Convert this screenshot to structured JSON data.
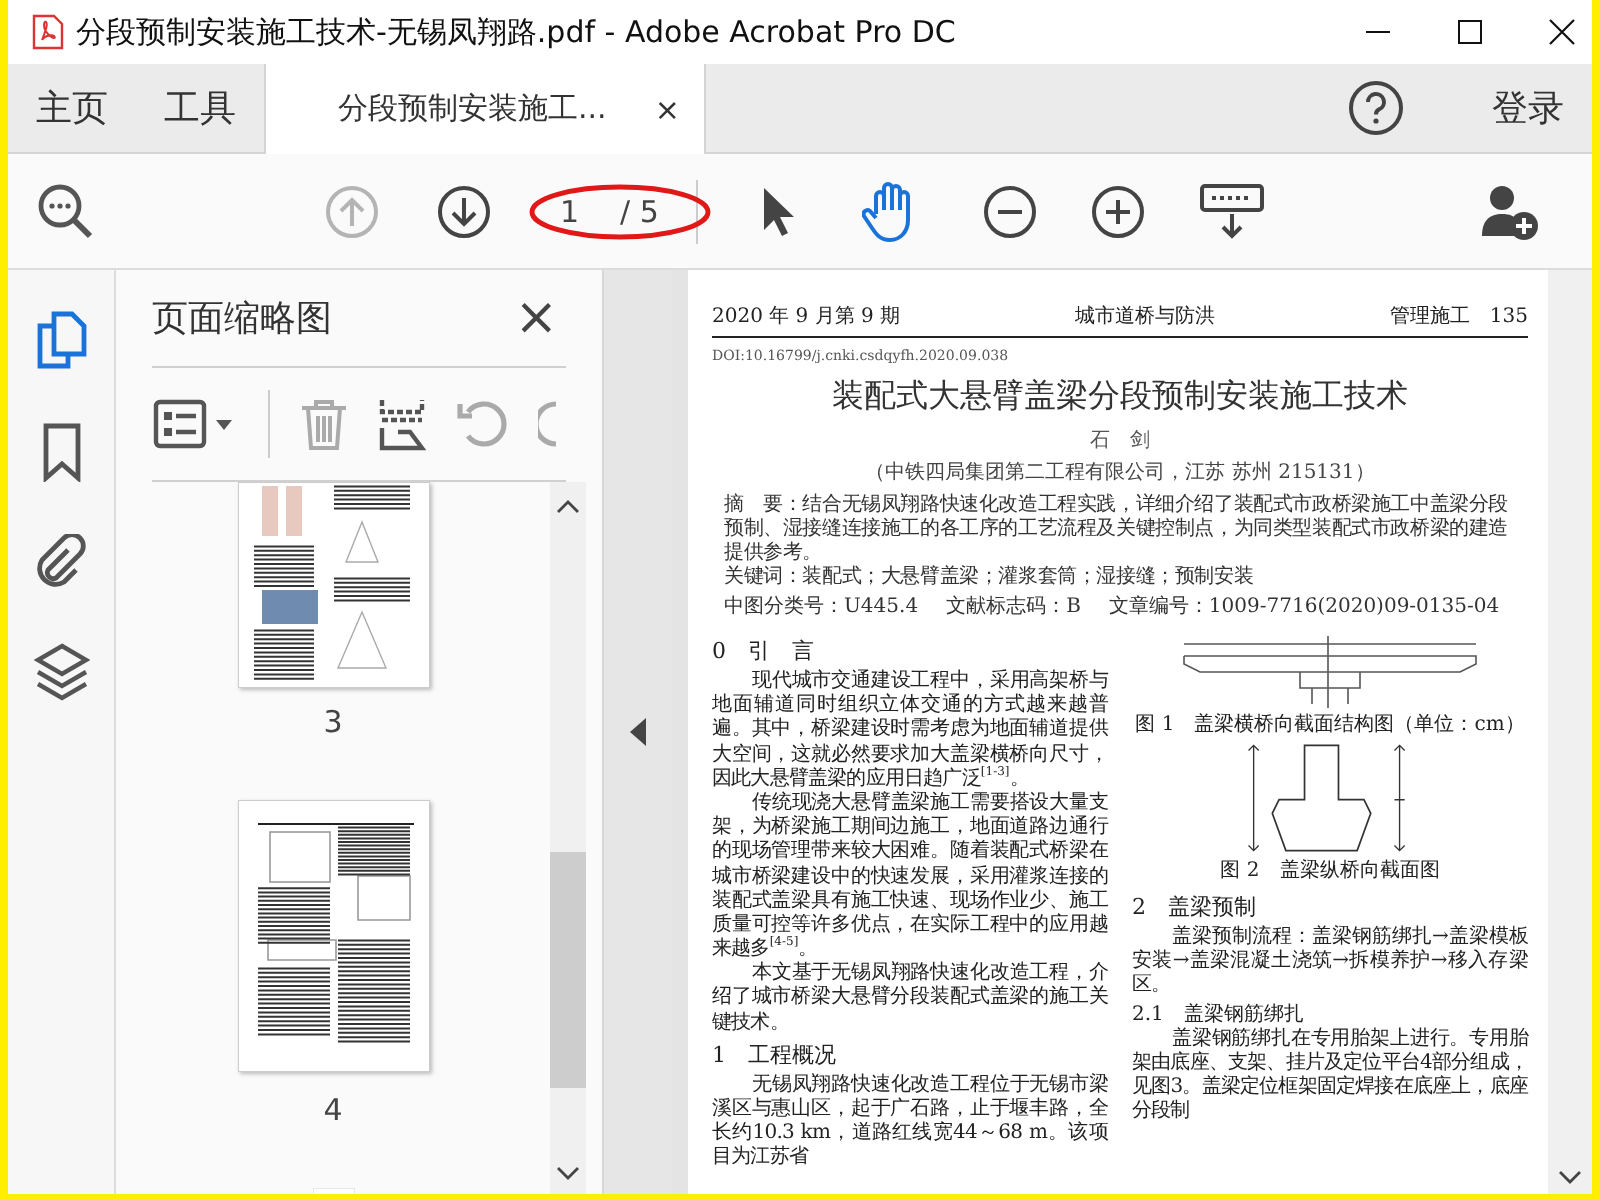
{
  "window": {
    "title": "分段预制安装施工技术-无锡凤翔路.pdf - Adobe Acrobat Pro DC"
  },
  "tabs": [
    {
      "label": "主页",
      "selected": false
    },
    {
      "label": "工具",
      "selected": false
    },
    {
      "label": "分段预制安装施工...",
      "selected": true,
      "close": "×"
    }
  ],
  "header_right": {
    "sign_in": "登录"
  },
  "toolbar": {
    "prev_page": {
      "disabled": true
    },
    "next_page": {
      "disabled": false
    },
    "page_current": "1",
    "page_total": "/ 5",
    "tools": [
      {
        "kind": "select",
        "selected": false
      },
      {
        "kind": "hand",
        "selected": true
      }
    ]
  },
  "left_rail": [
    {
      "kind": "pages",
      "selected": true
    },
    {
      "kind": "bookmarks",
      "selected": false
    },
    {
      "kind": "attachments",
      "selected": false
    },
    {
      "kind": "layers",
      "selected": false
    }
  ],
  "thumbnails_panel": {
    "title": "页面缩略图",
    "close": "×",
    "pages": [
      {
        "label": "3",
        "selected": false
      },
      {
        "label": "4",
        "selected": false
      }
    ]
  },
  "document": {
    "running_head": {
      "left": "2020 年 9 月第 9 期",
      "center": "城市道桥与防洪",
      "right": "管理施工　135"
    },
    "doi": "DOI:10.16799/j.cnki.csdqyfh.2020.09.038",
    "title": "装配式大悬臂盖梁分段预制安装施工技术",
    "author": "石　剑",
    "affiliation": "（中铁四局集团第二工程有限公司，江苏 苏州 215131）",
    "abstract": "摘　要：结合无锡凤翔路快速化改造工程实践，详细介绍了装配式市政桥梁施工中盖梁分段预制、湿接缝连接施工的各工序的工艺流程及关键控制点，为同类型装配式市政桥梁的建造提供参考。",
    "keywords": "关键词：装配式；大悬臂盖梁；灌浆套筒；湿接缝；预制安装",
    "meta": [
      "中图分类号：U445.4",
      "文献标志码：B",
      "文章编号：1009-7716(2020)09-0135-04"
    ],
    "left_column": [
      {
        "kind": "heading",
        "text": "0　引　言"
      },
      {
        "kind": "paragraph",
        "text": "现代城市交通建设工程中，采用高架桥与地面辅道同时组织立体交通的方式越来越普遍。其中，桥梁建设时需考虑为地面辅道提供大空间，这就必然要求加大盖梁横桥向尺寸，因此大悬臂盖梁的应用日趋广泛$^{[1-3]}$。"
      },
      {
        "kind": "paragraph",
        "text": "传统现浇大悬臂盖梁施工需要搭设大量支架，为桥梁施工期间边施工，地面道路边通行的现场管理带来较大困难。随着装配式桥梁在城市桥梁建设中的快速发展，采用灌浆连接的装配式盖梁具有施工快速、现场作业少、施工质量可控等许多优点，在实际工程中的应用越来越多$^{[4-5]}$。"
      },
      {
        "kind": "paragraph",
        "text": "本文基于无锡凤翔路快速化改造工程，介绍了城市桥梁大悬臂分段装配式盖梁的施工关键技术。"
      },
      {
        "kind": "heading",
        "text": "1　工程概况"
      },
      {
        "kind": "paragraph",
        "text": "无锡凤翔路快速化改造工程位于无锡市梁溪区与惠山区，起于广石路，止于堰丰路，全长约10.3 km，道路红线宽44～68 m。该项目为江苏省"
      }
    ],
    "right_column": [
      {
        "kind": "figure",
        "text": "图 1　盖梁横桥向截面结构图（单位：cm）"
      },
      {
        "kind": "figure",
        "text": "图 2　盖梁纵桥向截面图"
      },
      {
        "kind": "heading",
        "text": "2　盖梁预制"
      },
      {
        "kind": "paragraph",
        "text": "盖梁预制流程：盖梁钢筋绑扎→盖梁模板安装→盖梁混凝土浇筑→拆模养护→移入存梁区。"
      },
      {
        "kind": "subheading",
        "text": "2.1　盖梁钢筋绑扎"
      },
      {
        "kind": "paragraph",
        "text": "盖梁钢筋绑扎在专用胎架上进行。专用胎架由底座、支架、挂片及定位平台4部分组成，见图3。盖梁定位框架固定焊接在底座上，底座分段制"
      }
    ]
  }
}
